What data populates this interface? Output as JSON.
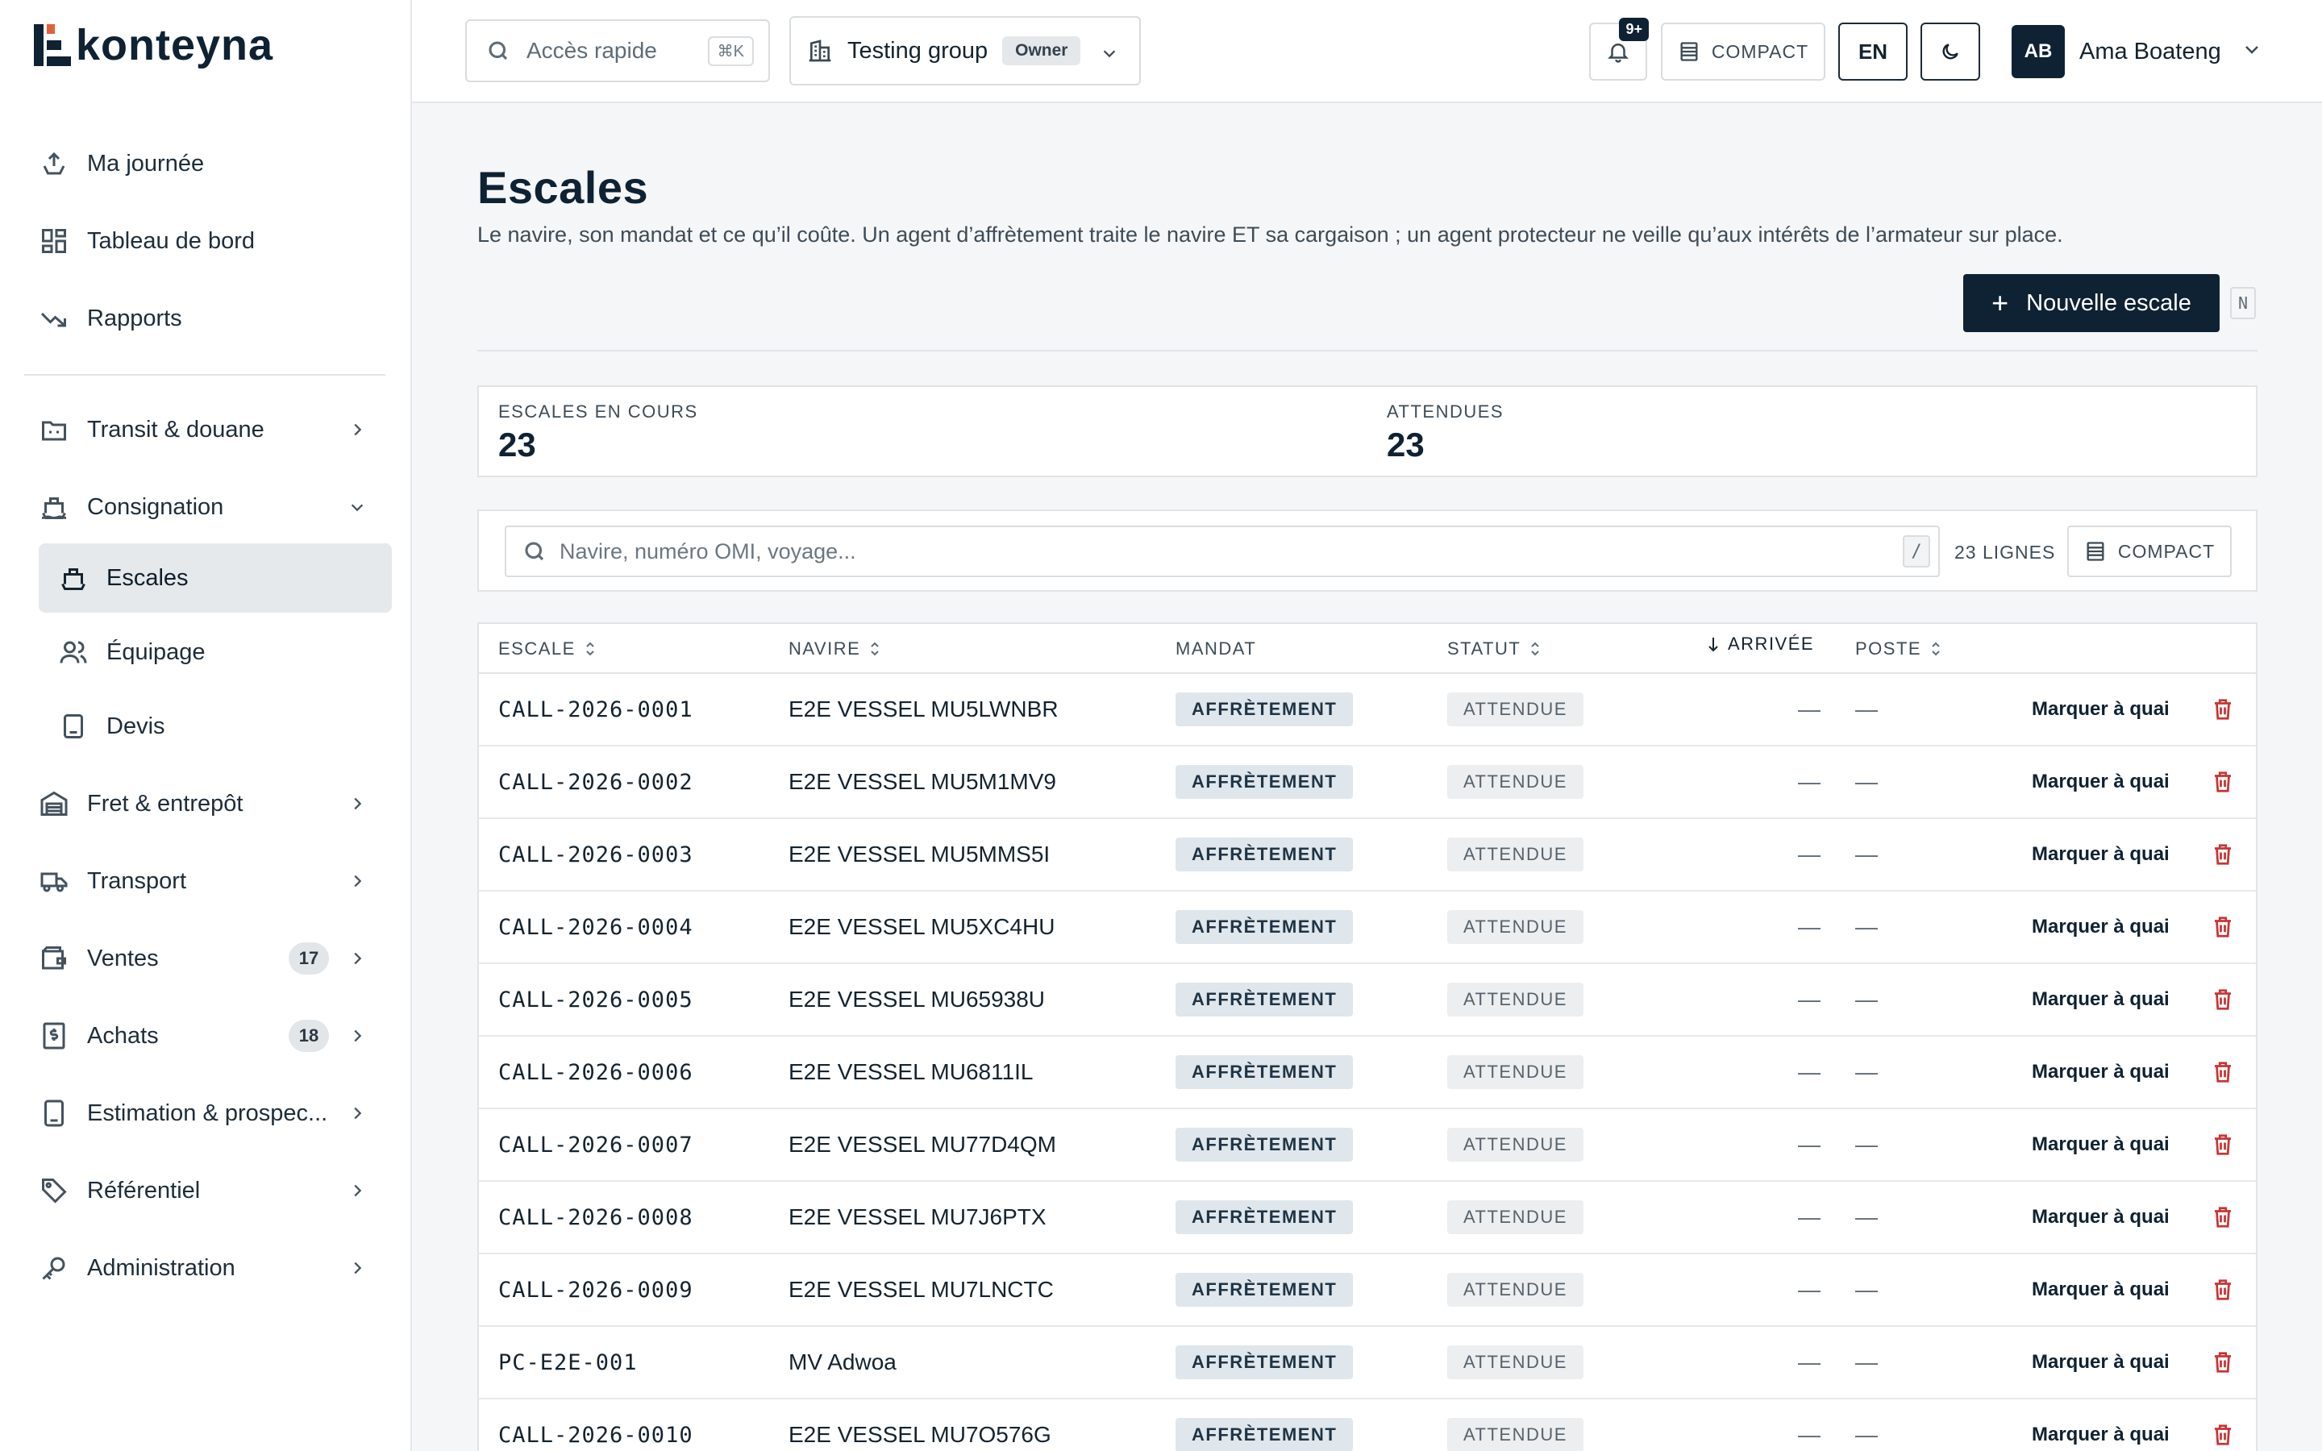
{
  "app": {
    "logo_text": "konteyna"
  },
  "sidebar": {
    "items": [
      {
        "label": "Ma journée",
        "icon": "upload-tray-icon"
      },
      {
        "label": "Tableau de bord",
        "icon": "dashboard-grid-icon"
      },
      {
        "label": "Rapports",
        "icon": "trend-down-icon"
      },
      {
        "label": "Transit & douane",
        "icon": "customs-icon"
      },
      {
        "label": "Consignation",
        "icon": "ship-icon"
      },
      {
        "label": "Escales",
        "icon": "ship-icon",
        "active": true
      },
      {
        "label": "Équipage",
        "icon": "users-icon"
      },
      {
        "label": "Devis",
        "icon": "document-icon"
      },
      {
        "label": "Fret & entrepôt",
        "icon": "warehouse-icon"
      },
      {
        "label": "Transport",
        "icon": "truck-icon"
      },
      {
        "label": "Ventes",
        "icon": "wallet-icon",
        "badge": "17"
      },
      {
        "label": "Achats",
        "icon": "dollar-receipt-icon",
        "badge": "18"
      },
      {
        "label": "Estimation & prospec...",
        "icon": "calculator-icon"
      },
      {
        "label": "Référentiel",
        "icon": "tag-icon"
      },
      {
        "label": "Administration",
        "icon": "key-icon"
      }
    ]
  },
  "header": {
    "quick_access": {
      "placeholder": "Accès rapide",
      "shortcut": "⌘K"
    },
    "group": {
      "name": "Testing group",
      "role": "Owner"
    },
    "notifications": {
      "count": "9+"
    },
    "compact_label": "COMPACT",
    "language": "EN",
    "user": {
      "initials": "AB",
      "name": "Ama Boateng"
    }
  },
  "page": {
    "title": "Escales",
    "description": "Le navire, son mandat et ce qu’il coûte. Un agent d’affrètement traite le navire ET sa cargaison ; un agent protecteur ne veille qu’aux intérêts de l’armateur sur place.",
    "new_button": "Nouvelle escale",
    "new_shortcut": "N"
  },
  "stats": [
    {
      "label": "ESCALES EN COURS",
      "value": "23"
    },
    {
      "label": "ATTENDUES",
      "value": "23"
    }
  ],
  "filter": {
    "search_placeholder": "Navire, numéro OMI, voyage...",
    "search_shortcut": "/",
    "rows_count": "23 LIGNES",
    "compact_label": "COMPACT"
  },
  "table": {
    "columns": {
      "escale": "ESCALE",
      "navire": "NAVIRE",
      "mandat": "MANDAT",
      "statut": "STATUT",
      "arrivee": "ARRIVÉE",
      "poste": "POSTE"
    },
    "action_label": "Marquer à quai",
    "rows": [
      {
        "escale": "CALL-2026-0001",
        "navire": "E2E VESSEL MU5LWNBR",
        "mandat": "AFFRÈTEMENT",
        "statut": "ATTENDUE",
        "arrivee": "—",
        "poste": "—"
      },
      {
        "escale": "CALL-2026-0002",
        "navire": "E2E VESSEL MU5M1MV9",
        "mandat": "AFFRÈTEMENT",
        "statut": "ATTENDUE",
        "arrivee": "—",
        "poste": "—"
      },
      {
        "escale": "CALL-2026-0003",
        "navire": "E2E VESSEL MU5MMS5I",
        "mandat": "AFFRÈTEMENT",
        "statut": "ATTENDUE",
        "arrivee": "—",
        "poste": "—"
      },
      {
        "escale": "CALL-2026-0004",
        "navire": "E2E VESSEL MU5XC4HU",
        "mandat": "AFFRÈTEMENT",
        "statut": "ATTENDUE",
        "arrivee": "—",
        "poste": "—"
      },
      {
        "escale": "CALL-2026-0005",
        "navire": "E2E VESSEL MU65938U",
        "mandat": "AFFRÈTEMENT",
        "statut": "ATTENDUE",
        "arrivee": "—",
        "poste": "—"
      },
      {
        "escale": "CALL-2026-0006",
        "navire": "E2E VESSEL MU6811IL",
        "mandat": "AFFRÈTEMENT",
        "statut": "ATTENDUE",
        "arrivee": "—",
        "poste": "—"
      },
      {
        "escale": "CALL-2026-0007",
        "navire": "E2E VESSEL MU77D4QM",
        "mandat": "AFFRÈTEMENT",
        "statut": "ATTENDUE",
        "arrivee": "—",
        "poste": "—"
      },
      {
        "escale": "CALL-2026-0008",
        "navire": "E2E VESSEL MU7J6PTX",
        "mandat": "AFFRÈTEMENT",
        "statut": "ATTENDUE",
        "arrivee": "—",
        "poste": "—"
      },
      {
        "escale": "CALL-2026-0009",
        "navire": "E2E VESSEL MU7LNCTC",
        "mandat": "AFFRÈTEMENT",
        "statut": "ATTENDUE",
        "arrivee": "—",
        "poste": "—"
      },
      {
        "escale": "PC-E2E-001",
        "navire": "MV Adwoa",
        "mandat": "AFFRÈTEMENT",
        "statut": "ATTENDUE",
        "arrivee": "—",
        "poste": "—"
      },
      {
        "escale": "CALL-2026-0010",
        "navire": "E2E VESSEL MU7O576G",
        "mandat": "AFFRÈTEMENT",
        "statut": "ATTENDUE",
        "arrivee": "—",
        "poste": "—"
      }
    ]
  },
  "colors": {
    "brand": "#0e2233",
    "danger": "#c73535",
    "chip_mandat": "#dfe6ec"
  }
}
